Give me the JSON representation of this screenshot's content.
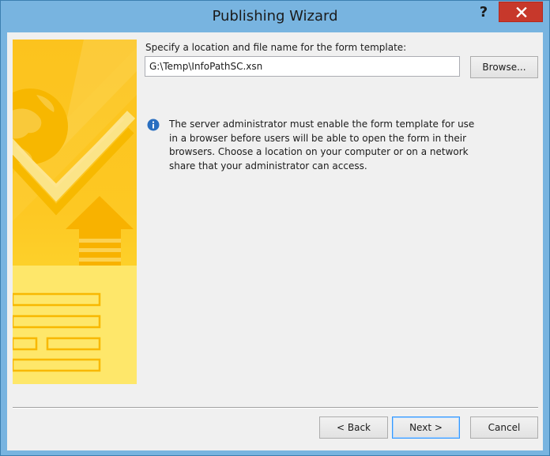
{
  "window": {
    "title": "Publishing Wizard",
    "help_label": "?"
  },
  "form": {
    "prompt": "Specify a location and file name for the form template:",
    "path_value": "G:\\Temp\\InfoPathSC.xsn",
    "browse_label": "Browse..."
  },
  "info": {
    "icon": "info-icon",
    "message": "The server administrator must enable the form template for use in a browser before users will be able to open the form in their browsers. Choose a location on your computer or on a network share that your administrator can access."
  },
  "buttons": {
    "back_label": "< Back",
    "next_label": "Next >",
    "cancel_label": "Cancel"
  },
  "colors": {
    "titlebar": "#78b4e0",
    "close": "#c7382b",
    "banner": "#fbc51a",
    "info_icon": "#2a6fc0"
  }
}
